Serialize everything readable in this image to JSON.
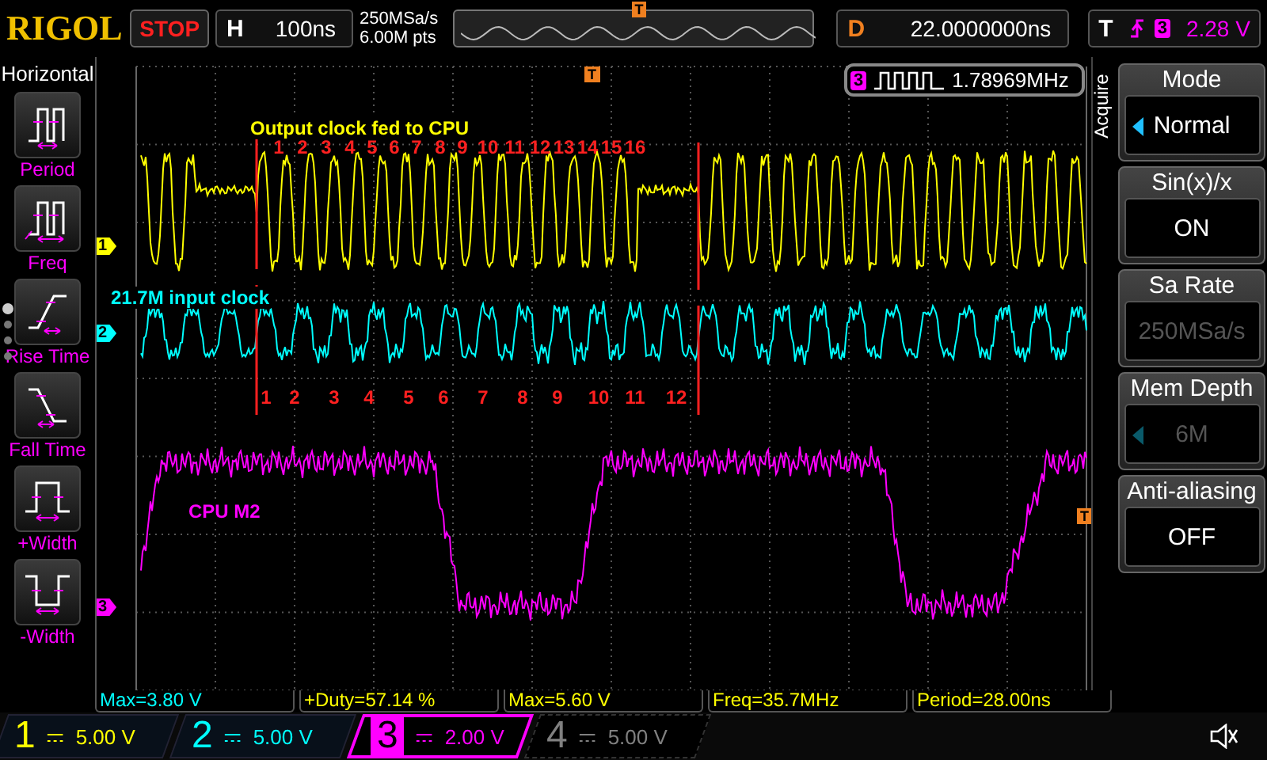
{
  "top_bar": {
    "logo": "RIGOL",
    "run_state": "STOP",
    "timebase": {
      "label": "H",
      "value": "100ns"
    },
    "sample_rate": "250MSa/s",
    "memory_points": "6.00M pts",
    "trigger_position_marker": "T",
    "delay": {
      "label": "D",
      "value": "22.0000000ns"
    },
    "trigger": {
      "label": "T",
      "source": "3",
      "level": "2.28 V"
    }
  },
  "sidebar": {
    "title": "Horizontal",
    "items": [
      {
        "label": "Period"
      },
      {
        "label": "Freq"
      },
      {
        "label": "Rise Time"
      },
      {
        "label": "Fall Time"
      },
      {
        "label": "+Width"
      },
      {
        "label": "-Width"
      }
    ]
  },
  "display": {
    "trigger_time_marker": "T",
    "trigger_level_marker": "T",
    "frequency_counter": {
      "channel": "3",
      "value": "1.78969MHz"
    },
    "channel_markers": [
      {
        "label": "1",
        "color": "#ffff00"
      },
      {
        "label": "2",
        "color": "#00ffff"
      },
      {
        "label": "3",
        "color": "#ff00ff"
      }
    ],
    "annotations": [
      {
        "text": "Output clock fed to CPU",
        "color": "#ffff00"
      },
      {
        "text": "21.7M input clock",
        "color": "#00ffff"
      },
      {
        "text": "CPU M2",
        "color": "#ff00ff"
      }
    ],
    "output_cycle_labels": [
      "1",
      "2",
      "3",
      "4",
      "5",
      "6",
      "7",
      "8",
      "9",
      "10",
      "11",
      "12",
      "13",
      "14",
      "15",
      "16"
    ],
    "input_cycle_labels": [
      "1",
      "2",
      "3",
      "4",
      "5",
      "6",
      "7",
      "8",
      "9",
      "10",
      "11",
      "12"
    ]
  },
  "acquire_menu": {
    "title": "Acquire",
    "items": [
      {
        "label": "Mode",
        "value": "Normal",
        "disabled": false,
        "arrow": true
      },
      {
        "label": "Sin(x)/x",
        "value": "ON",
        "disabled": false,
        "arrow": false
      },
      {
        "label": "Sa Rate",
        "value": "250MSa/s",
        "disabled": true,
        "arrow": false
      },
      {
        "label": "Mem Depth",
        "value": "6M",
        "disabled": true,
        "arrow": true
      },
      {
        "label": "Anti-aliasing",
        "value": "OFF",
        "disabled": false,
        "arrow": false
      }
    ]
  },
  "measurements": [
    {
      "text": "Max=3.80 V",
      "color": "#00ffff"
    },
    {
      "text": "+Duty=57.14 %",
      "color": "#ffff00"
    },
    {
      "text": "Max=5.60 V",
      "color": "#ffff00"
    },
    {
      "text": "Freq=35.7MHz",
      "color": "#ffff00"
    },
    {
      "text": "Period=28.00ns",
      "color": "#ffff00"
    }
  ],
  "channels": [
    {
      "number": "1",
      "scale": "5.00 V",
      "color": "#ffff00",
      "on": true,
      "selected": false
    },
    {
      "number": "2",
      "scale": "5.00 V",
      "color": "#00ffff",
      "on": true,
      "selected": false
    },
    {
      "number": "3",
      "scale": "2.00 V",
      "color": "#ff00ff",
      "on": true,
      "selected": true
    },
    {
      "number": "4",
      "scale": "5.00 V",
      "color": "#808080",
      "on": false,
      "selected": false
    }
  ]
}
